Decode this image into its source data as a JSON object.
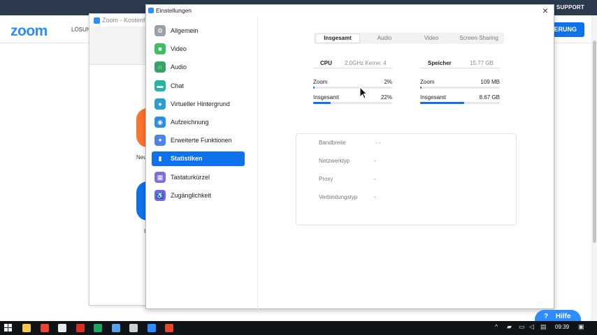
{
  "browser": {
    "support_label": "SUPPORT",
    "logo": "zoom",
    "nav_text": "LÖSUN",
    "cta_label": "IERUNG",
    "help_label": "Hilfe"
  },
  "bg_window": {
    "title": "Zoom - Kostenfre",
    "orange_label": "Neu",
    "blue_label": "I"
  },
  "settings": {
    "title": "Einstellungen",
    "close_glyph": "×",
    "sidebar": [
      {
        "label": "Allgemein",
        "icon": "gear-icon",
        "color": "#9aa0a6",
        "glyph": "⚙"
      },
      {
        "label": "Video",
        "icon": "video-icon",
        "color": "#3fbf5f",
        "glyph": "■"
      },
      {
        "label": "Audio",
        "icon": "headphones-icon",
        "color": "#35a565",
        "glyph": "∩"
      },
      {
        "label": "Chat",
        "icon": "chat-icon",
        "color": "#22b4a6",
        "glyph": "▬"
      },
      {
        "label": "Virtueller Hintergrund",
        "icon": "person-icon",
        "color": "#2a9dd4",
        "glyph": "●"
      },
      {
        "label": "Aufzeichnung",
        "icon": "record-icon",
        "color": "#2a8fe6",
        "glyph": "◉"
      },
      {
        "label": "Erweiterte Funktionen",
        "icon": "sparkle-icon",
        "color": "#4d83f0",
        "glyph": "✦"
      },
      {
        "label": "Statistiken",
        "icon": "bar-chart-icon",
        "color": "#0e72ed",
        "glyph": "▮"
      },
      {
        "label": "Tastaturkürzel",
        "icon": "keyboard-icon",
        "color": "#7b6fe0",
        "glyph": "▦"
      },
      {
        "label": "Zugänglichkeit",
        "icon": "accessibility-icon",
        "color": "#7966d9",
        "glyph": "♿"
      }
    ],
    "active_index": 7,
    "tabs": [
      "Insgesamt",
      "Audio",
      "Video",
      "Screen-Sharing"
    ],
    "active_tab": 0,
    "cpu": {
      "label": "CPU",
      "info": "2.0GHz  Kerne: 4",
      "rows": [
        {
          "label": "Zoom",
          "value": "2%",
          "level": 0.02
        },
        {
          "label": "Insgesamt",
          "value": "22%",
          "level": 0.22
        }
      ]
    },
    "memory": {
      "label": "Speicher",
      "info": "15.77 GB",
      "rows": [
        {
          "label": "Zoom",
          "value": "109 MB",
          "level": 0.007
        },
        {
          "label": "Insgesamt",
          "value": "8.67 GB",
          "level": 0.55
        }
      ]
    },
    "network": [
      {
        "label": "Bandbreite",
        "value": "-  -"
      },
      {
        "label": "Netzwerktyp",
        "value": "-"
      },
      {
        "label": "Proxy",
        "value": "-"
      },
      {
        "label": "Verbindungstyp",
        "value": "-"
      }
    ]
  },
  "taskbar": {
    "clock": "09:39",
    "apps": [
      {
        "name": "file-explorer-icon",
        "color": "#f2c94c"
      },
      {
        "name": "chrome-icon",
        "color": "#e94335"
      },
      {
        "name": "chat-app-icon",
        "color": "#e8e8e8"
      },
      {
        "name": "record-app-icon",
        "color": "#d93025"
      },
      {
        "name": "drive-icon",
        "color": "#1fa463"
      },
      {
        "name": "notepad-icon",
        "color": "#5aa0e6"
      },
      {
        "name": "calculator-icon",
        "color": "#cfcfcf"
      },
      {
        "name": "zoom-app-icon",
        "color": "#2d8cff"
      },
      {
        "name": "presentation-app-icon",
        "color": "#e04a2a"
      }
    ]
  }
}
